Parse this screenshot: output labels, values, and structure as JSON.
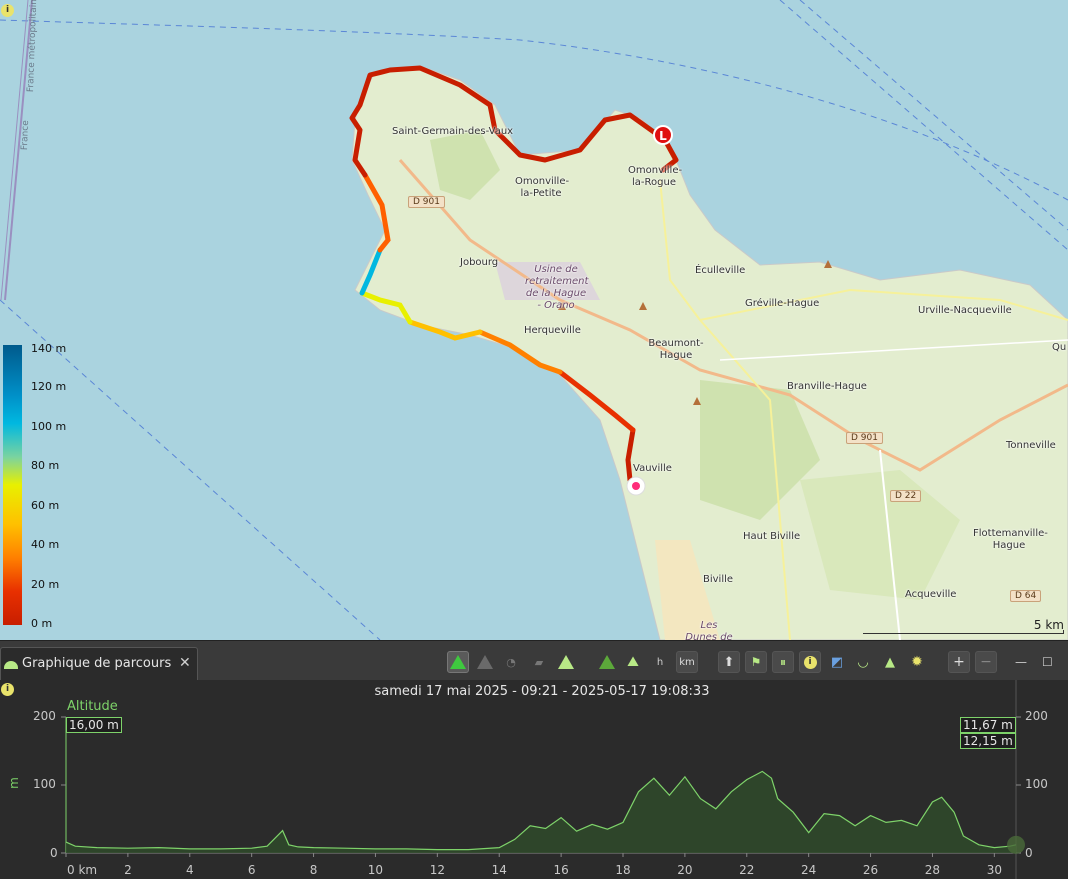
{
  "map": {
    "places": [
      {
        "name": "Saint-Germain-\ndes-Vaux",
        "label": "Saint-Germain-des-Vaux"
      },
      {
        "label": "Omonville-la-Petite"
      },
      {
        "label": "Omonville-la-Rogue"
      },
      {
        "label": "Jobourg"
      },
      {
        "label": "Herqueville"
      },
      {
        "label": "Éculleville"
      },
      {
        "label": "Gréville-Hague"
      },
      {
        "label": "Urville-Nacqueville"
      },
      {
        "label": "Beaumont-Hague"
      },
      {
        "label": "Branville-Hague"
      },
      {
        "label": "Tonneville"
      },
      {
        "label": "Vauville"
      },
      {
        "label": "Haut Biville"
      },
      {
        "label": "Biville"
      },
      {
        "label": "Flottemanville-Hague"
      },
      {
        "label": "Acqueville"
      },
      {
        "label": "Qu"
      }
    ],
    "usine_label": "Usine de retraitement de la Hague - Orano",
    "dunes_label": "Les Dunes de Biville",
    "roads": {
      "d901_a": "D 901",
      "d901_b": "D 901",
      "d22": "D 22",
      "d64": "D 64"
    },
    "border_label_1": "France métropolitaine",
    "border_label_2": "France",
    "marker_letter": "L",
    "scale_text": "5 km",
    "legend": {
      "labels": [
        "140 m",
        "120 m",
        "100 m",
        "80 m",
        "60 m",
        "40 m",
        "20 m",
        "0 m"
      ]
    }
  },
  "panel": {
    "tab_title": "Graphique de parcours",
    "close_glyph": "✕",
    "toolbar": {
      "km_label": "km",
      "plus": "+",
      "minus": "−",
      "info": "i"
    }
  },
  "chart": {
    "title": "samedi 17 mai 2025 - 09:21 - 2025-05-17 19:08:33",
    "altitude_label": "Altitude",
    "start_value": "16,00 m",
    "right_value_1": "11,67 m",
    "right_value_2": "12,15 m",
    "unit_label": "m",
    "y_ticks_left": [
      "200",
      "100",
      "0"
    ],
    "y_ticks_right": [
      "200",
      "100",
      "0"
    ],
    "x_ticks": [
      "0 km",
      "2",
      "4",
      "6",
      "8",
      "10",
      "12",
      "14",
      "16",
      "18",
      "20",
      "22",
      "24",
      "26",
      "28",
      "30"
    ]
  },
  "chart_data": {
    "type": "area",
    "title": "samedi 17 mai 2025 - 09:21 - 2025-05-17 19:08:33",
    "series": [
      {
        "name": "Altitude",
        "x": [
          0,
          0.3,
          1,
          2,
          3,
          4,
          5,
          6,
          6.5,
          7,
          7.2,
          7.5,
          8,
          9,
          10,
          11,
          12,
          13,
          14,
          14.5,
          15,
          15.5,
          16,
          16.5,
          17,
          17.5,
          18,
          18.5,
          19,
          19.5,
          20,
          20.5,
          21,
          21.5,
          22,
          22.5,
          22.8,
          23,
          23.5,
          24,
          24.5,
          25,
          25.5,
          26,
          26.5,
          27,
          27.5,
          28,
          28.3,
          28.7,
          29,
          29.5,
          30,
          30.5,
          30.7
        ],
        "y": [
          16,
          10,
          8,
          7,
          8,
          6,
          6,
          7,
          10,
          33,
          12,
          9,
          8,
          7,
          6,
          6,
          5,
          5,
          8,
          20,
          40,
          36,
          52,
          32,
          42,
          35,
          45,
          90,
          110,
          85,
          112,
          80,
          65,
          90,
          108,
          120,
          110,
          80,
          60,
          30,
          58,
          55,
          40,
          55,
          45,
          48,
          40,
          75,
          82,
          60,
          25,
          12,
          8,
          10,
          12
        ]
      }
    ],
    "xlabel": "",
    "ylabel": "m",
    "xlim": [
      0,
      30.7
    ],
    "ylim": [
      0,
      200
    ],
    "legend": "none",
    "grid": false
  }
}
